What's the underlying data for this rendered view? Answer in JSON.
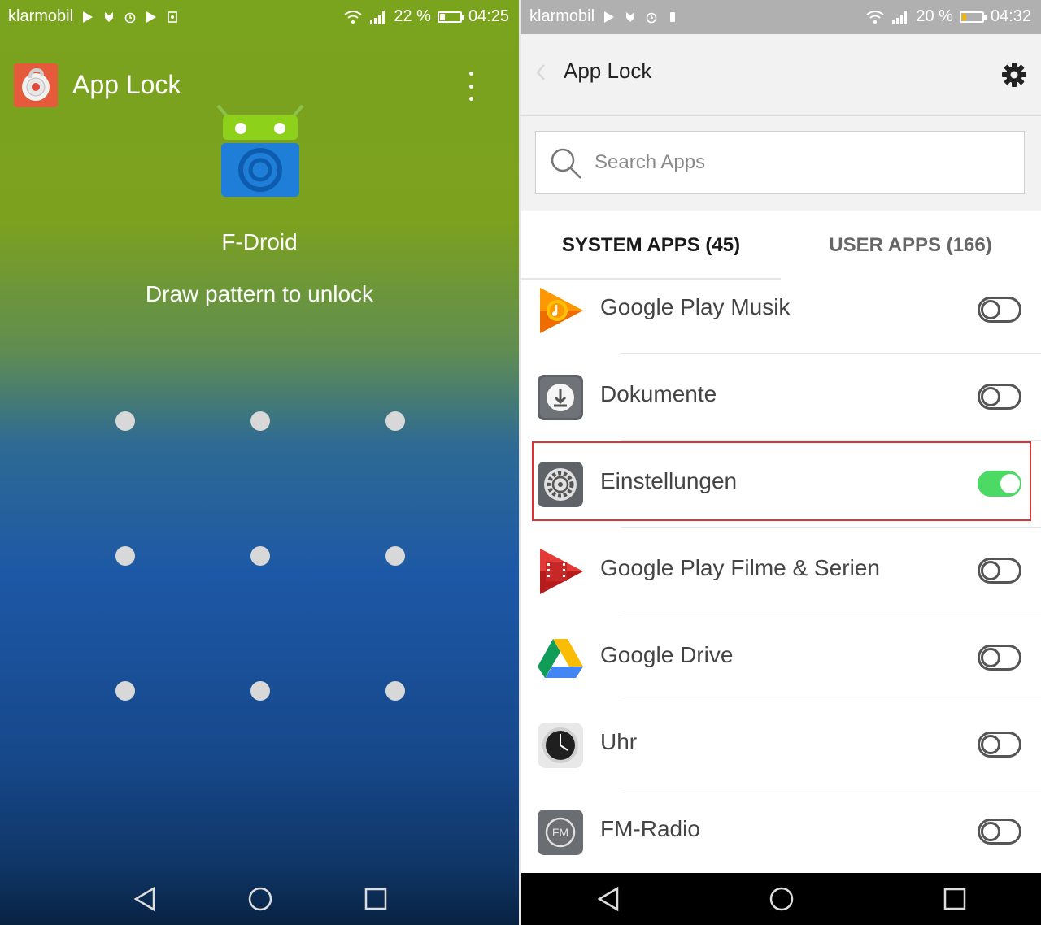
{
  "left": {
    "status": {
      "carrier": "klarmobil",
      "battery": "22 %",
      "battery_level": 0.22,
      "time": "04:25"
    },
    "header": {
      "title": "App Lock"
    },
    "lock": {
      "app_name": "F-Droid",
      "hint": "Draw pattern to unlock",
      "pattern_dots": 9
    },
    "nav": {
      "back": "back-icon",
      "home": "home-icon",
      "recents": "recents-icon"
    }
  },
  "right": {
    "status": {
      "carrier": "klarmobil",
      "battery": "20 %",
      "battery_level": 0.2,
      "time": "04:32"
    },
    "toolbar": {
      "title": "App Lock"
    },
    "search": {
      "placeholder": "Search Apps"
    },
    "tabs": [
      {
        "label": "SYSTEM APPS (45)",
        "active": true
      },
      {
        "label": "USER APPS (166)",
        "active": false
      }
    ],
    "apps": [
      {
        "name": "Google Play Musik",
        "icon": "google-play-music-icon",
        "locked": false
      },
      {
        "name": "Dokumente",
        "icon": "documents-icon",
        "locked": false
      },
      {
        "name": "Einstellungen",
        "icon": "settings-icon",
        "locked": true,
        "highlighted": true
      },
      {
        "name": "Google Play Filme & Serien",
        "icon": "google-play-movies-icon",
        "locked": false
      },
      {
        "name": "Google Drive",
        "icon": "google-drive-icon",
        "locked": false
      },
      {
        "name": "Uhr",
        "icon": "clock-icon",
        "locked": false
      },
      {
        "name": "FM-Radio",
        "icon": "fm-radio-icon",
        "locked": false
      }
    ],
    "colors": {
      "toggle_on": "#4cd964",
      "highlight": "#e03030"
    }
  }
}
